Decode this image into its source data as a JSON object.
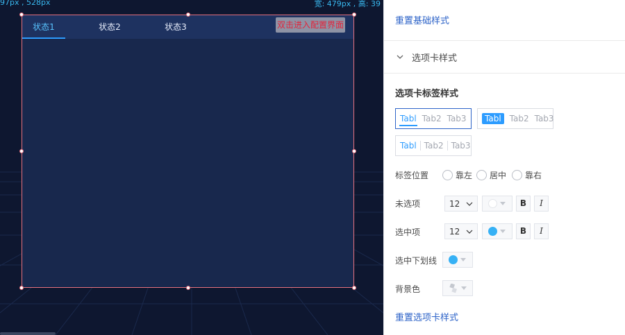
{
  "canvas": {
    "position_readout": "97px , 528px",
    "size_readout": "宽: 479px , 高: 39",
    "widget": {
      "tabs": [
        {
          "label": "状态1",
          "active": true
        },
        {
          "label": "状态2",
          "active": false
        },
        {
          "label": "状态3",
          "active": false
        }
      ],
      "edit_hint": "双击进入配置界面"
    }
  },
  "panel": {
    "reset_base_link": "重置基础样式",
    "section_title": "选项卡样式",
    "tab_label_style_title": "选项卡标签样式",
    "style_options": [
      {
        "tabs": [
          "Tabl",
          "Tab2",
          "Tab3"
        ],
        "selected": true
      },
      {
        "tabs": [
          "Tabl",
          "Tab2",
          "Tab3"
        ],
        "selected": false
      },
      {
        "tabs": [
          "Tabl",
          "Tab2",
          "Tab3"
        ],
        "selected": false
      }
    ],
    "label_position": {
      "label": "标签位置",
      "options": [
        "靠左",
        "居中",
        "靠右"
      ]
    },
    "unselected": {
      "label": "未选项",
      "font_size": "12",
      "color": "#ffffff",
      "bold_label": "B",
      "italic_label": "I"
    },
    "selected": {
      "label": "选中项",
      "font_size": "12",
      "color": "#36b1f5",
      "bold_label": "B",
      "italic_label": "I"
    },
    "underline": {
      "label": "选中下划线",
      "color": "#36b1f5"
    },
    "background": {
      "label": "背景色",
      "icon": "color-empty-icon"
    },
    "reset_tab_link": "重置选项卡样式"
  },
  "colors": {
    "accent": "#2d63c8",
    "tab_active": "#2d9cff",
    "selection_border": "#e8727f"
  }
}
